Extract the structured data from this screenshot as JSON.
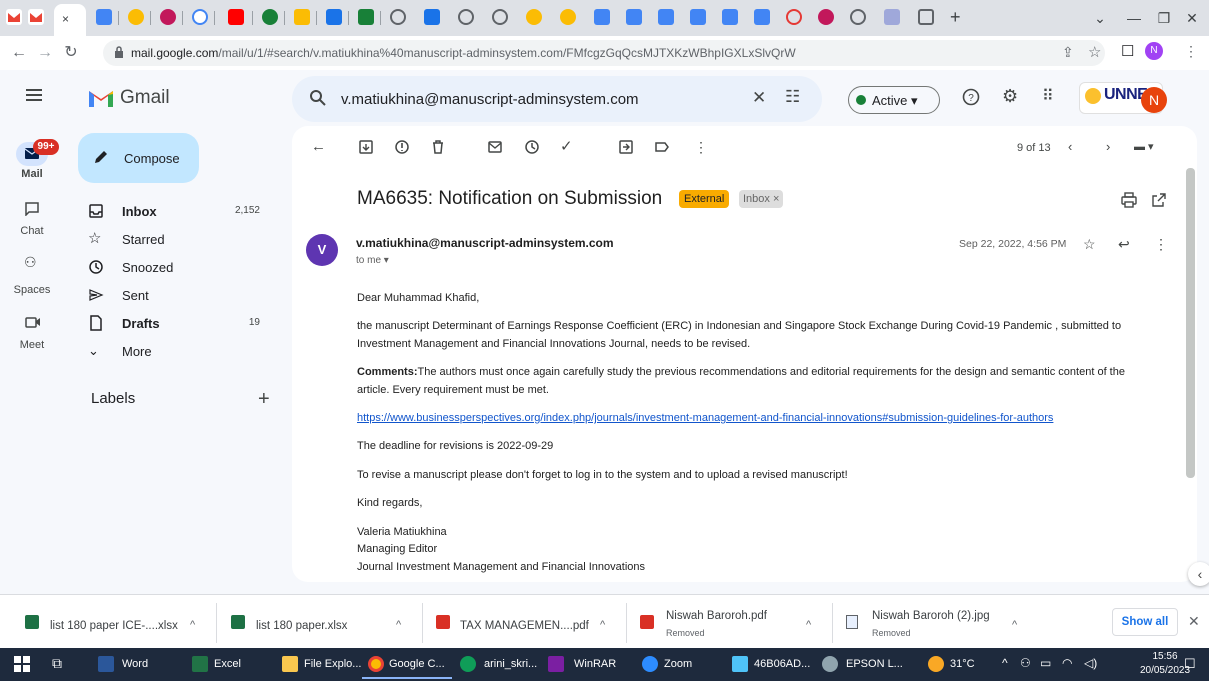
{
  "browser": {
    "url_prefix": "mail.google.com",
    "url_rest": "/mail/u/1/#search/v.matiukhina%40manuscript-adminsystem.com/FMfcgzGqQcsMJTXKzWBhpIGXLxSlvQrW",
    "profile_initial": "N"
  },
  "gmail": {
    "brand": "Gmail",
    "search_value": "v.matiukhina@manuscript-adminsystem.com",
    "status_label": "Active",
    "org_logo_text": "UNNES",
    "account_initial": "N",
    "rail": {
      "mail_label": "Mail",
      "mail_badge": "99+",
      "chat_label": "Chat",
      "spaces_label": "Spaces",
      "meet_label": "Meet"
    },
    "compose_label": "Compose",
    "nav": [
      {
        "label": "Inbox",
        "count": "2,152"
      },
      {
        "label": "Starred",
        "count": ""
      },
      {
        "label": "Snoozed",
        "count": ""
      },
      {
        "label": "Sent",
        "count": ""
      },
      {
        "label": "Drafts",
        "count": "19"
      },
      {
        "label": "More",
        "count": ""
      }
    ],
    "labels_title": "Labels",
    "pager": "9 of 13",
    "email": {
      "subject": "MA6635: Notification on Submission",
      "tag_external": "External",
      "tag_inbox": "Inbox ×",
      "sender_initial": "V",
      "sender": "v.matiukhina@manuscript-adminsystem.com",
      "to": "to me",
      "date": "Sep 22, 2022, 4:56 PM",
      "greeting": "Dear Muhammad Khafid,",
      "p1_line1": "the manuscript Determinant of Earnings Response Coefficient (ERC) in Indonesian and Singapore Stock Exchange During Covid-19 Pandemic , submitted to",
      "p1_line2": "Investment Management and Financial Innovations Journal, needs to be revised.",
      "comments_label": "Comments:",
      "comments_line1": "The authors must once again carefully study the previous recommendations and editorial requirements for the design and semantic content of the",
      "comments_line2": "article. Every requirement must be met.",
      "link": "https://www.businessperspectives.org/index.php/journals/investment-management-and-financial-innovations#submission-guidelines-for-authors",
      "deadline": "The deadline for revisions is 2022-09-29",
      "instruction": "To revise a manuscript please don't forget to log in to the system and to upload a revised manuscript!",
      "closing": "Kind regards,",
      "sig_name": "Valeria Matiukhina",
      "sig_title": "Managing Editor",
      "sig_org": "Journal Investment Management and Financial Innovations"
    }
  },
  "downloads": {
    "items": [
      {
        "name": "list 180 paper ICE-....xlsx",
        "sub": ""
      },
      {
        "name": "list 180 paper.xlsx",
        "sub": ""
      },
      {
        "name": "TAX MANAGEMEN....pdf",
        "sub": ""
      },
      {
        "name": "Niswah Baroroh.pdf",
        "sub": "Removed"
      },
      {
        "name": "Niswah Baroroh (2).jpg",
        "sub": "Removed"
      }
    ],
    "show_all": "Show all"
  },
  "taskbar": {
    "apps": [
      "Word",
      "Excel",
      "File Explo...",
      "Google C...",
      "arini_skri...",
      "WinRAR",
      "Zoom",
      "46B06AD...",
      "EPSON L..."
    ],
    "weather": "31°C",
    "time": "15:56",
    "date": "20/05/2023"
  }
}
